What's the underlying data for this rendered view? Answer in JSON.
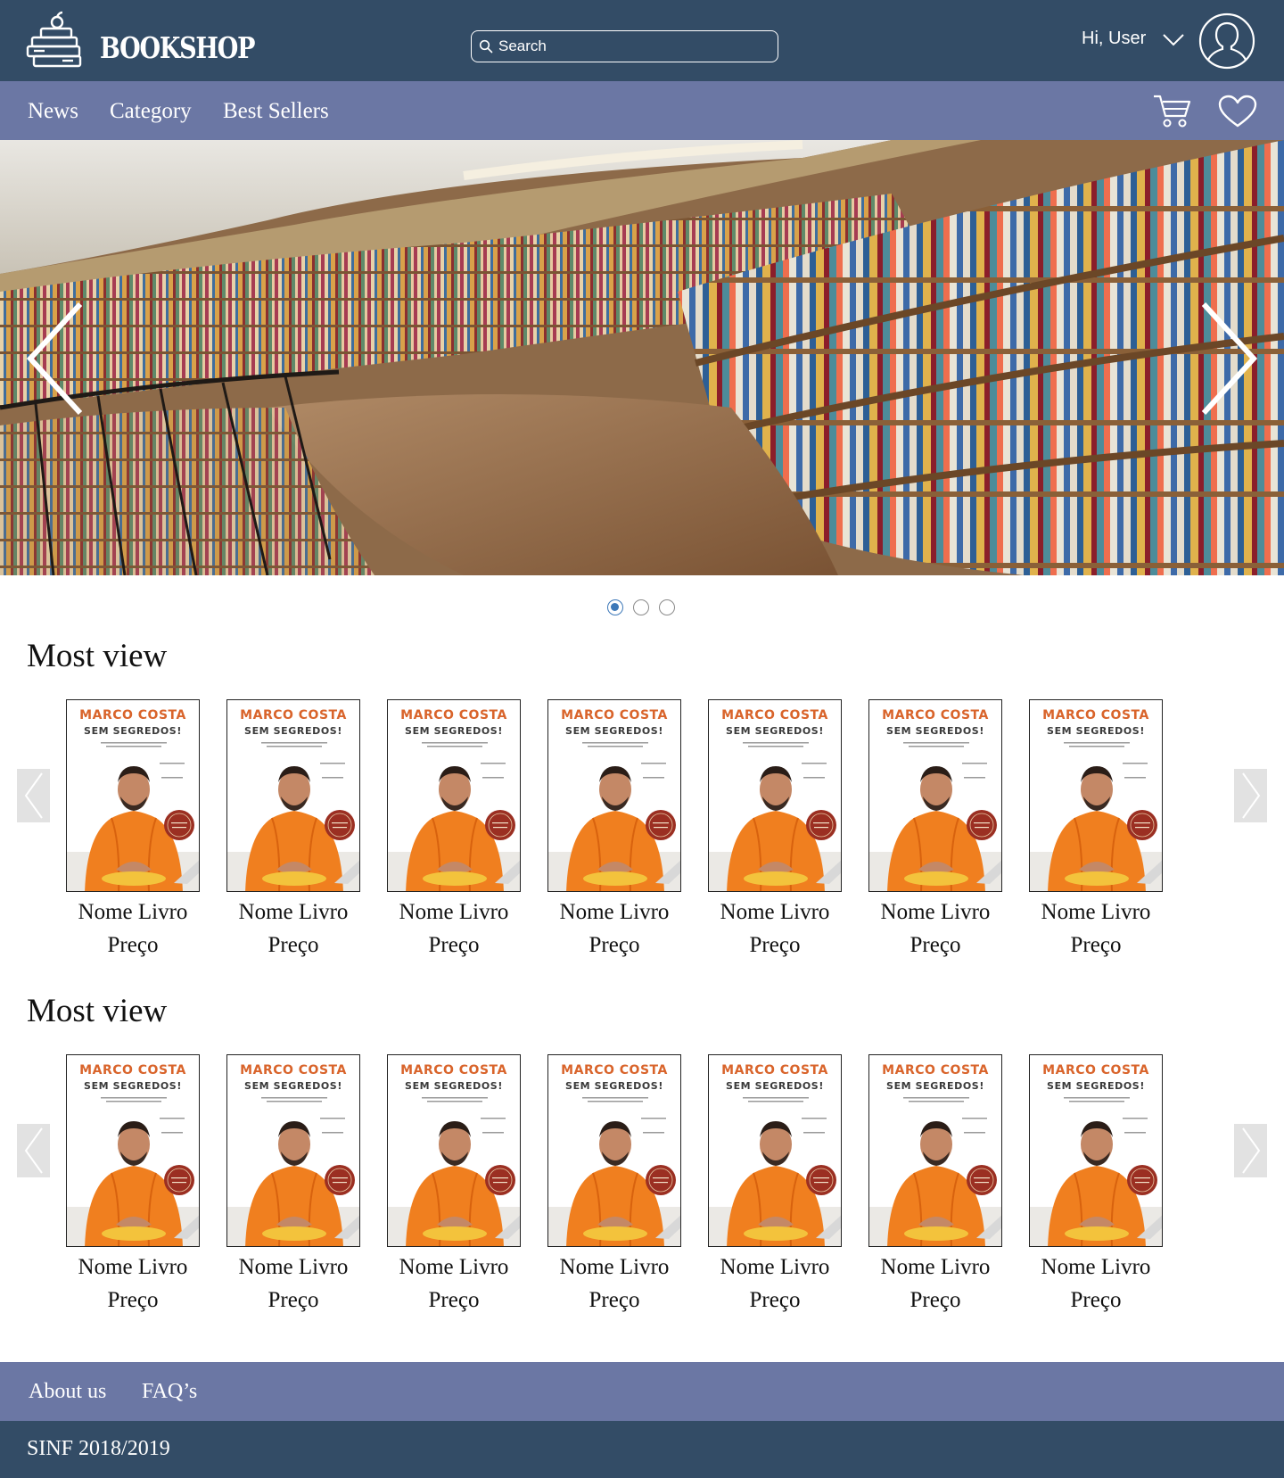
{
  "header": {
    "brand": "BOOKSHOP",
    "search_placeholder": "Search",
    "greeting": "Hi, User"
  },
  "nav": {
    "links": [
      "News",
      "Category",
      "Best Sellers"
    ]
  },
  "hero": {
    "slide_count": 3,
    "active_slide": 1
  },
  "sections": [
    {
      "title": "Most view",
      "products": [
        {
          "name": "Nome Livro",
          "price": "Preço"
        },
        {
          "name": "Nome Livro",
          "price": "Preço"
        },
        {
          "name": "Nome Livro",
          "price": "Preço"
        },
        {
          "name": "Nome Livro",
          "price": "Preço"
        },
        {
          "name": "Nome Livro",
          "price": "Preço"
        },
        {
          "name": "Nome Livro",
          "price": "Preço"
        },
        {
          "name": "Nome Livro",
          "price": "Preço"
        }
      ]
    },
    {
      "title": "Most view",
      "products": [
        {
          "name": "Nome Livro",
          "price": "Preço"
        },
        {
          "name": "Nome Livro",
          "price": "Preço"
        },
        {
          "name": "Nome Livro",
          "price": "Preço"
        },
        {
          "name": "Nome Livro",
          "price": "Preço"
        },
        {
          "name": "Nome Livro",
          "price": "Preço"
        },
        {
          "name": "Nome Livro",
          "price": "Preço"
        },
        {
          "name": "Nome Livro",
          "price": "Preço"
        }
      ]
    }
  ],
  "book_cover": {
    "author": "MARCO COSTA",
    "title": "SEM SEGREDOS!"
  },
  "footer": {
    "links": [
      "About us",
      "FAQ’s"
    ],
    "copyright": "SINF 2018/2019"
  },
  "colors": {
    "header_dark": "#334c66",
    "nav_purple": "#6b77a4",
    "accent_blue": "#3d78b8",
    "cover_orange": "#d9642b"
  },
  "icons": [
    "bookshop-logo-icon",
    "search-icon",
    "chevron-down-icon",
    "user-avatar-icon",
    "cart-icon",
    "heart-icon",
    "chevron-left-icon",
    "chevron-right-icon"
  ]
}
